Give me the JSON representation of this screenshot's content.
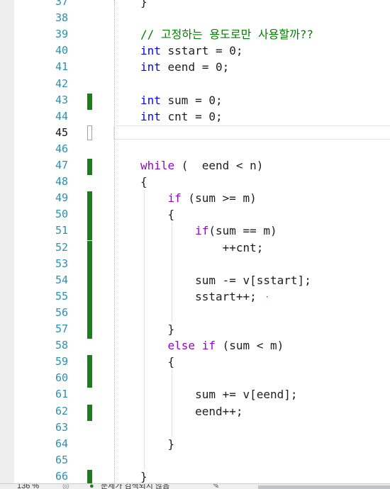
{
  "lines": [
    {
      "n": "37",
      "change": "none",
      "tokens": [
        {
          "t": "}",
          "c": "p"
        }
      ]
    },
    {
      "n": "38",
      "change": "none",
      "tokens": []
    },
    {
      "n": "39",
      "change": "none",
      "tokens": [
        {
          "t": "// 고정하는 용도로만 사용할까??",
          "c": "cm"
        }
      ]
    },
    {
      "n": "40",
      "change": "none",
      "tokens": [
        {
          "t": "int",
          "c": "kw"
        },
        {
          "t": " sstart = 0;",
          "c": "p"
        }
      ]
    },
    {
      "n": "41",
      "change": "none",
      "tokens": [
        {
          "t": "int",
          "c": "kw"
        },
        {
          "t": " eend = 0;",
          "c": "p"
        }
      ]
    },
    {
      "n": "42",
      "change": "none",
      "tokens": []
    },
    {
      "n": "43",
      "change": "saved",
      "tokens": [
        {
          "t": "int",
          "c": "kw"
        },
        {
          "t": " sum = 0;",
          "c": "p"
        }
      ]
    },
    {
      "n": "44",
      "change": "none",
      "tokens": [
        {
          "t": "int",
          "c": "kw"
        },
        {
          "t": " cnt = 0;",
          "c": "p"
        }
      ]
    },
    {
      "n": "45",
      "change": "unsaved",
      "current": true,
      "tokens": []
    },
    {
      "n": "46",
      "change": "none",
      "tokens": []
    },
    {
      "n": "47",
      "change": "saved",
      "tokens": [
        {
          "t": "while",
          "c": "ctrl"
        },
        {
          "t": " (  eend < n)",
          "c": "p"
        }
      ]
    },
    {
      "n": "48",
      "change": "none",
      "tokens": [
        {
          "t": "{",
          "c": "p"
        }
      ]
    },
    {
      "n": "49",
      "change": "saved",
      "tokens": [
        {
          "t": "    ",
          "c": "p"
        },
        {
          "t": "if",
          "c": "ctrl"
        },
        {
          "t": " (sum >= m)",
          "c": "p"
        }
      ]
    },
    {
      "n": "50",
      "change": "saved",
      "tokens": [
        {
          "t": "    {",
          "c": "p"
        }
      ]
    },
    {
      "n": "51",
      "change": "saved",
      "tokens": [
        {
          "t": "        ",
          "c": "p"
        },
        {
          "t": "if",
          "c": "ctrl"
        },
        {
          "t": "(sum == m)",
          "c": "p"
        }
      ]
    },
    {
      "n": "52",
      "change": "saved",
      "tokens": [
        {
          "t": "            ++cnt;",
          "c": "p"
        }
      ]
    },
    {
      "n": "53",
      "change": "saved",
      "tokens": []
    },
    {
      "n": "54",
      "change": "saved",
      "tokens": [
        {
          "t": "        sum -= v[sstart];",
          "c": "p"
        }
      ]
    },
    {
      "n": "55",
      "change": "saved",
      "tokens": [
        {
          "t": "        sstart++;",
          "c": "p"
        }
      ],
      "squiggle": true
    },
    {
      "n": "56",
      "change": "saved",
      "tokens": []
    },
    {
      "n": "57",
      "change": "saved",
      "tokens": [
        {
          "t": "    }",
          "c": "p"
        }
      ]
    },
    {
      "n": "58",
      "change": "none",
      "tokens": [
        {
          "t": "    ",
          "c": "p"
        },
        {
          "t": "else",
          "c": "ctrl"
        },
        {
          "t": " ",
          "c": "p"
        },
        {
          "t": "if",
          "c": "ctrl"
        },
        {
          "t": " (sum < m)",
          "c": "p"
        }
      ]
    },
    {
      "n": "59",
      "change": "saved",
      "tokens": [
        {
          "t": "    {",
          "c": "p"
        }
      ]
    },
    {
      "n": "60",
      "change": "saved",
      "tokens": []
    },
    {
      "n": "61",
      "change": "none",
      "tokens": [
        {
          "t": "        sum += v[eend];",
          "c": "p"
        }
      ]
    },
    {
      "n": "62",
      "change": "saved",
      "tokens": [
        {
          "t": "        eend++;",
          "c": "p"
        }
      ]
    },
    {
      "n": "63",
      "change": "none",
      "tokens": []
    },
    {
      "n": "64",
      "change": "none",
      "tokens": [
        {
          "t": "    }",
          "c": "p"
        }
      ]
    },
    {
      "n": "65",
      "change": "none",
      "tokens": []
    },
    {
      "n": "66",
      "change": "saved",
      "tokens": [
        {
          "t": "}",
          "c": "p"
        }
      ]
    }
  ],
  "status": {
    "zoom": "136 %",
    "issues": "문제가 검색되지 않음"
  },
  "colors": {
    "keyword": "#0000ff",
    "control_keyword": "#8f08c4",
    "comment": "#008000",
    "line_number": "#2b91af",
    "saved_change": "#1a7f1a",
    "unsaved_change": "#c9a227"
  },
  "icons": {
    "issues": "check-circle-icon"
  }
}
